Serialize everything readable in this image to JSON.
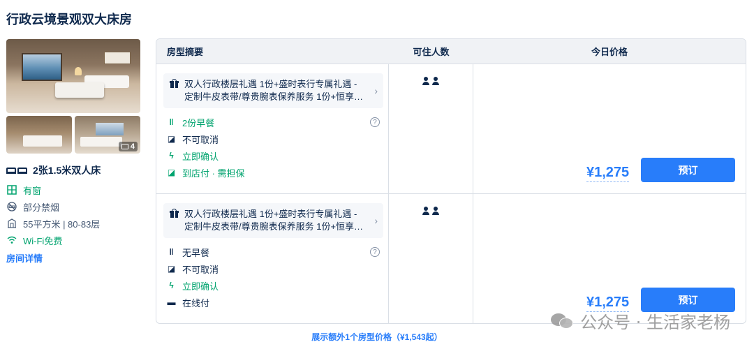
{
  "room": {
    "title": "行政云境景观双大床房",
    "photo_count": "4",
    "bed": "2张1.5米双人床",
    "features": [
      {
        "icon": "window-icon",
        "text": "有窗"
      },
      {
        "icon": "no-smoking-icon",
        "text": "部分禁烟"
      },
      {
        "icon": "area-icon",
        "text": "55平方米 | 80-83层"
      },
      {
        "icon": "wifi-icon",
        "text": "Wi-Fi免费"
      }
    ],
    "detail_link": "房间详情"
  },
  "table": {
    "headers": {
      "summary": "房型摘要",
      "guests": "可住人数",
      "price": "今日价格"
    },
    "rows": [
      {
        "gift": "双人行政楼层礼遇 1份+盛时表行专属礼遇 - 定制牛皮表带/尊贵腕表保养服务 1份+恒享…",
        "policies": {
          "meal": "2份早餐",
          "cancel": "不可取消",
          "confirm": "立即确认",
          "payment": "到店付 · 需担保"
        },
        "guest_count": 2,
        "price": "¥1,275",
        "book_label": "预订"
      },
      {
        "gift": "双人行政楼层礼遇 1份+盛时表行专属礼遇 - 定制牛皮表带/尊贵腕表保养服务 1份+恒享…",
        "policies": {
          "meal": "无早餐",
          "cancel": "不可取消",
          "confirm": "立即确认",
          "payment": "在线付"
        },
        "guest_count": 2,
        "price": "¥1,275",
        "book_label": "预订"
      }
    ],
    "more_link": "展示额外1个房型价格（¥1,543起）"
  },
  "watermark": "公众号 · 生活家老杨",
  "colors": {
    "accent": "#287dfa",
    "green": "#00a36e",
    "text": "#0f294d"
  }
}
